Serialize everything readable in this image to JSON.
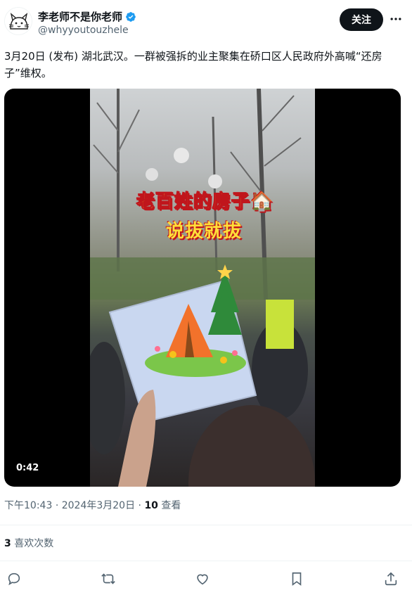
{
  "author": {
    "display_name": "李老师不是你老师",
    "handle": "@whyyoutouzhele",
    "avatar_icon": "cat-doodle-avatar",
    "verified_icon": "verified-badge-icon"
  },
  "header": {
    "follow_label": "关注",
    "more_icon": "more-horizontal-icon"
  },
  "tweet": {
    "text": "3月20日 (发布) 湖北武汉。一群被强拆的业主聚集在硚口区人民政府外高喊“还房子”维权。"
  },
  "media": {
    "duration": "0:42",
    "overlay_line1": "老百姓的房子🏠",
    "overlay_line2": "说拔就拔"
  },
  "meta": {
    "time": "下午10:43",
    "separator": "·",
    "date": "2024年3月20日",
    "views_count": "10",
    "views_label": "查看"
  },
  "stats": {
    "likes_count": "3",
    "likes_label": "喜欢次数"
  },
  "actions": {
    "reply_icon": "reply-icon",
    "retweet_icon": "retweet-icon",
    "like_icon": "heart-icon",
    "bookmark_icon": "bookmark-icon",
    "share_icon": "share-icon"
  },
  "colors": {
    "text_primary": "#0f1419",
    "text_secondary": "#536471",
    "verified_blue": "#1d9bf0",
    "follow_button_bg": "#0f1419"
  }
}
